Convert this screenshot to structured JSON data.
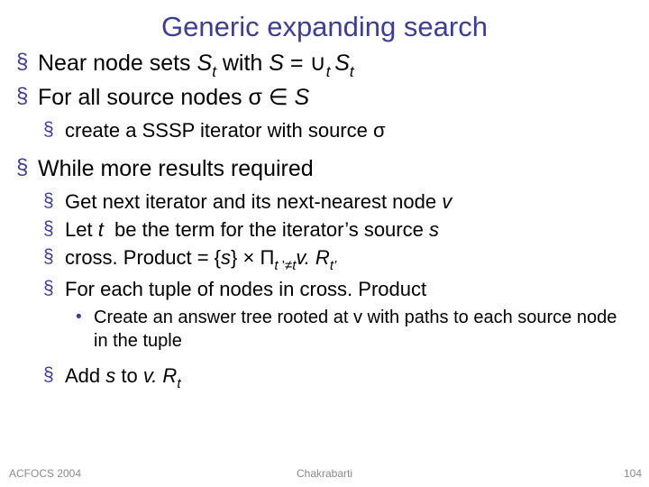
{
  "title": "Generic expanding search",
  "bullets": {
    "b1_html": "Near node sets <span class='ital'>S<span class='sub'>t</span></span> with <span class='ital'>S</span> = &#8746;<span class='sub ital'>t&nbsp;</span><span class='ital'>S<span class='sub'>t</span></span>",
    "b2_html": "For all source nodes &#963; &#8712; <span class='ital'>S</span>",
    "b2_1_html": "create a SSSP iterator with source &#963;",
    "b3_html": "While more results required",
    "b3_1_html": "Get next iterator and its next-nearest node <span class='ital'>v</span>",
    "b3_2_html": "Let <span class='ital'>t</span>&nbsp; be the term for the iterator&rsquo;s source <span class='ital'>s</span>",
    "b3_3_html": "cross. Product = {<span class='ital'>s</span>} &#215; &#928;<span class='sub'><span class='ital'>t&nbsp;</span>&rsquo;&#8800;<span class='ital'>t</span></span><span class='ital'>v. R<span class='sub'>t&rsquo;</span></span>",
    "b3_4_html": "For each tuple of nodes in cross. Product",
    "b3_4_1_html": "Create an answer tree rooted at v with paths to each source node in the tuple",
    "b3_5_html": "Add <span class='ital'>s</span> to <span class='ital'>v. R<span class='sub'>t</span></span>"
  },
  "footer": {
    "left": "ACFOCS 2004",
    "center": "Chakrabarti",
    "right": "104"
  }
}
